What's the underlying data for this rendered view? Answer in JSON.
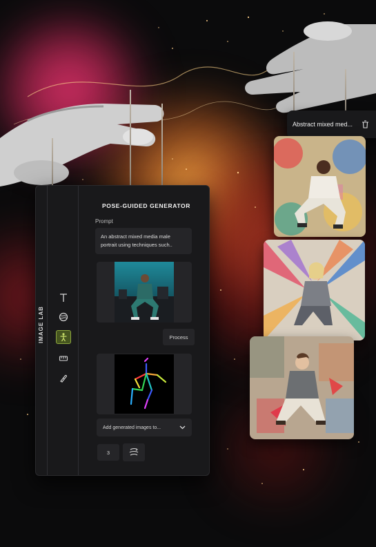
{
  "panel": {
    "sidebar_title": "IMAGE LAB",
    "heading": "POSE-GUIDED GENERATOR",
    "prompt_label": "Prompt",
    "prompt_text": "An abstract mixed media male portrait using techniques such..",
    "process_label": "Process",
    "add_images_placeholder": "Add generated images to...",
    "count_value": "3",
    "tools": [
      {
        "icon": "text-tool-icon"
      },
      {
        "icon": "style-tool-icon"
      },
      {
        "icon": "pose-tool-icon",
        "active": true
      },
      {
        "icon": "ruler-tool-icon"
      },
      {
        "icon": "eraser-tool-icon"
      }
    ]
  },
  "results": {
    "title": "Abstract mixed med...",
    "delete_icon": "trash-icon"
  },
  "colors": {
    "panel_bg": "#19191b",
    "card_bg": "#252528",
    "accent": "#8ea83e",
    "pose_red": "#ff3b3b",
    "pose_green": "#33d455",
    "pose_blue": "#3d5bff",
    "pose_yellow": "#f7e23a",
    "pose_magenta": "#e040fb"
  }
}
